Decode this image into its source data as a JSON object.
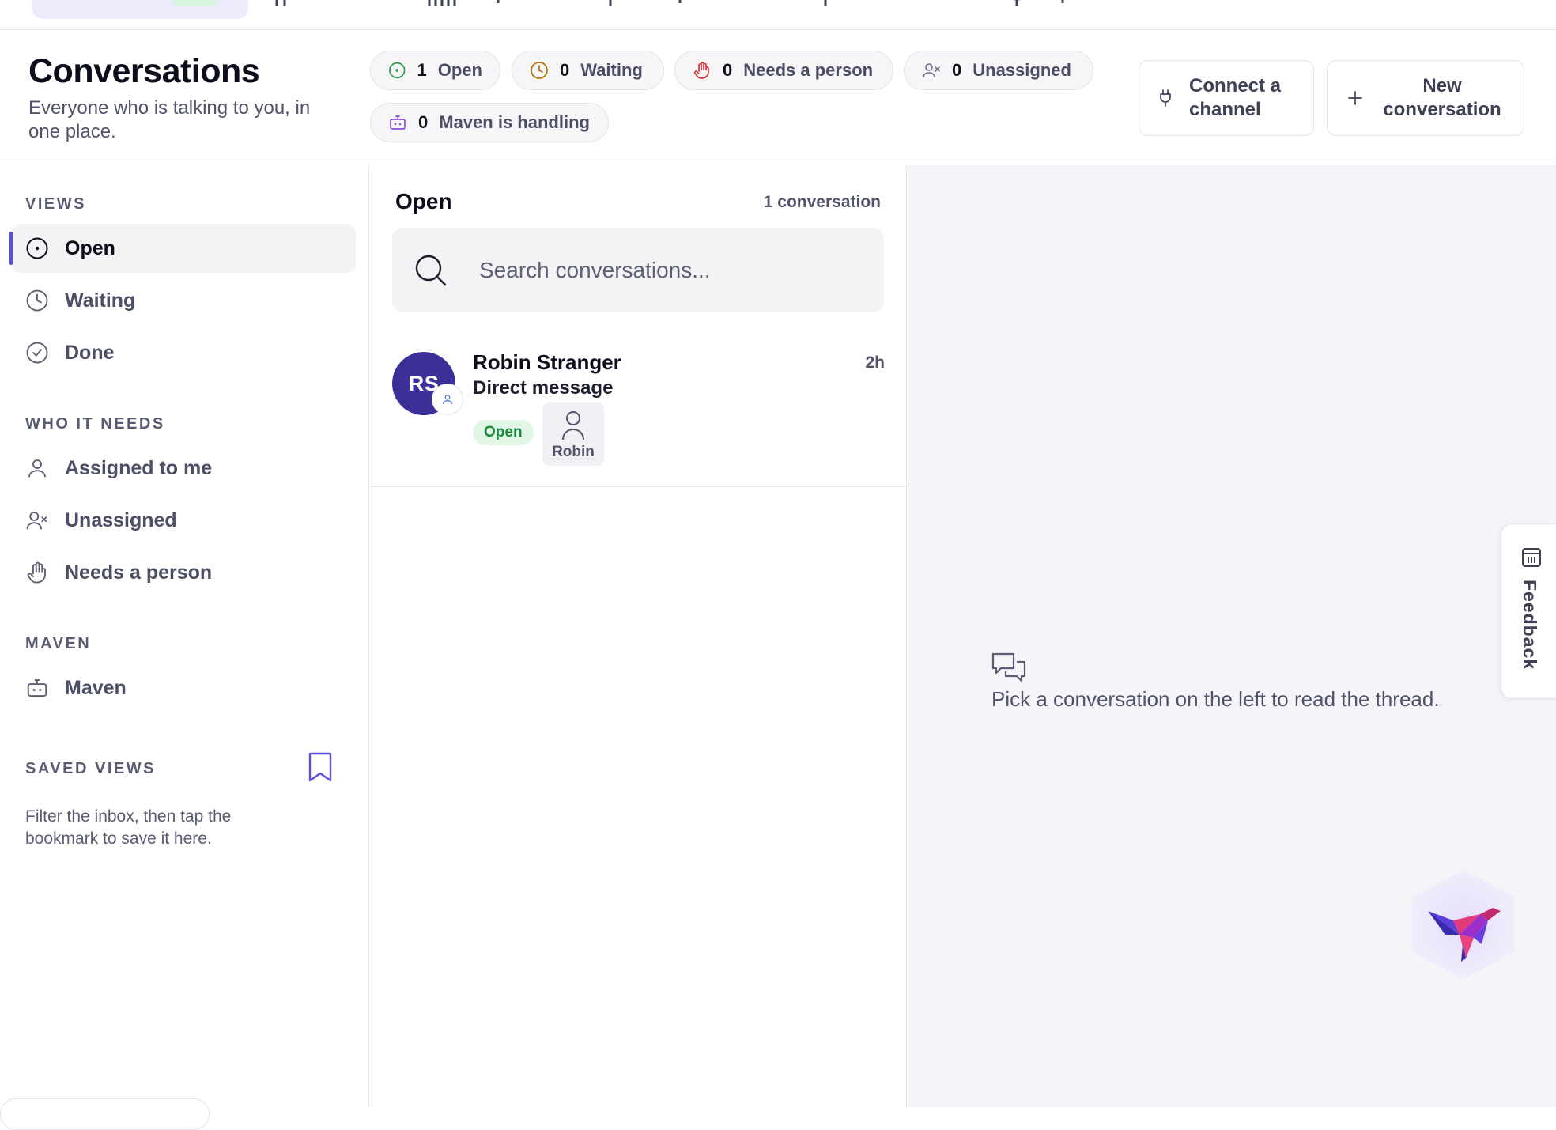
{
  "header": {
    "title": "Conversations",
    "subtitle": "Everyone who is talking to you, in one place."
  },
  "pills": [
    {
      "count": "1",
      "label": "Open",
      "icon": "open-circle-icon",
      "color": "#2a9d4b"
    },
    {
      "count": "0",
      "label": "Waiting",
      "icon": "clock-icon",
      "color": "#b9770e"
    },
    {
      "count": "0",
      "label": "Needs a person",
      "icon": "hand-icon",
      "color": "#d93636"
    },
    {
      "count": "0",
      "label": "Unassigned",
      "icon": "user-x-icon",
      "color": "#6b6e82"
    },
    {
      "count": "0",
      "label": "Maven is handling",
      "icon": "bot-icon",
      "color": "#8b4fd8"
    }
  ],
  "actions": {
    "connect": "Connect a channel",
    "new": "New conversation"
  },
  "sidebar": {
    "views_heading": "VIEWS",
    "views": [
      {
        "label": "Open",
        "icon": "open-circle-icon"
      },
      {
        "label": "Waiting",
        "icon": "clock-icon"
      },
      {
        "label": "Done",
        "icon": "check-circle-icon"
      }
    ],
    "needs_heading": "WHO IT NEEDS",
    "needs": [
      {
        "label": "Assigned to me",
        "icon": "user-icon"
      },
      {
        "label": "Unassigned",
        "icon": "user-x-icon"
      },
      {
        "label": "Needs a person",
        "icon": "hand-icon"
      }
    ],
    "maven_heading": "MAVEN",
    "maven": [
      {
        "label": "Maven",
        "icon": "bot-icon"
      }
    ],
    "saved_heading": "SAVED VIEWS",
    "saved_hint": "Filter the inbox, then tap the bookmark to save it here."
  },
  "list": {
    "heading": "Open",
    "count": "1 conversation",
    "search_placeholder": "Search conversations...",
    "conversations": [
      {
        "initials": "RS",
        "name": "Robin Stranger",
        "channel": "Direct message",
        "time": "2h",
        "status": "Open",
        "assignee": "Robin"
      }
    ]
  },
  "thread": {
    "empty": "Pick a conversation on the left to read the thread."
  },
  "feedback": "Feedback",
  "colors": {
    "accent": "#5b51d8",
    "avatar": "#3b2f98",
    "open_badge_bg": "#e2f6e6",
    "open_badge_text": "#1a8a3a"
  }
}
